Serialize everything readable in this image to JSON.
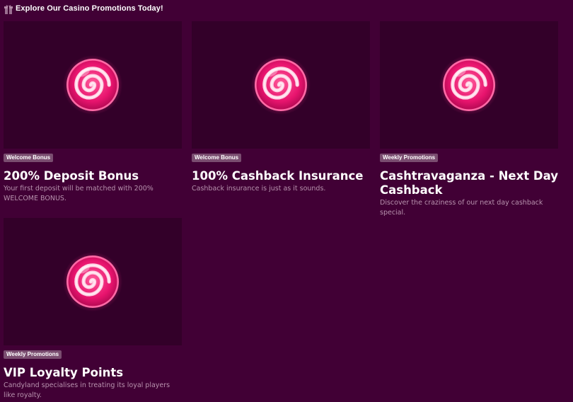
{
  "header": {
    "title": "Explore Our Casino Promotions Today!",
    "icon": "gift-icon"
  },
  "colors": {
    "background": "#410035",
    "card_image_bg": "#330029",
    "badge_bg": "#7a4d70",
    "description": "#b893ae",
    "candy_pink": "#e8146e"
  },
  "promotions": [
    {
      "badge": "Welcome Bonus",
      "title": "200% Deposit Bonus",
      "description": "Your first deposit will be matched with 200% WELCOME BONUS.",
      "icon": "lollipop-swirl-icon"
    },
    {
      "badge": "Welcome Bonus",
      "title": "100% Cashback Insurance",
      "description": "Cashback insurance is just as it sounds.",
      "icon": "lollipop-swirl-icon"
    },
    {
      "badge": "Weekly Promotions",
      "title": "Cashtravaganza - Next Day Cashback",
      "description": "Discover the craziness of our next day cashback special.",
      "icon": "lollipop-swirl-icon"
    },
    {
      "badge": "Weekly Promotions",
      "title": "VIP Loyalty Points",
      "description": "Candyland specialises in treating its loyal players like royalty.",
      "icon": "lollipop-swirl-icon"
    }
  ]
}
